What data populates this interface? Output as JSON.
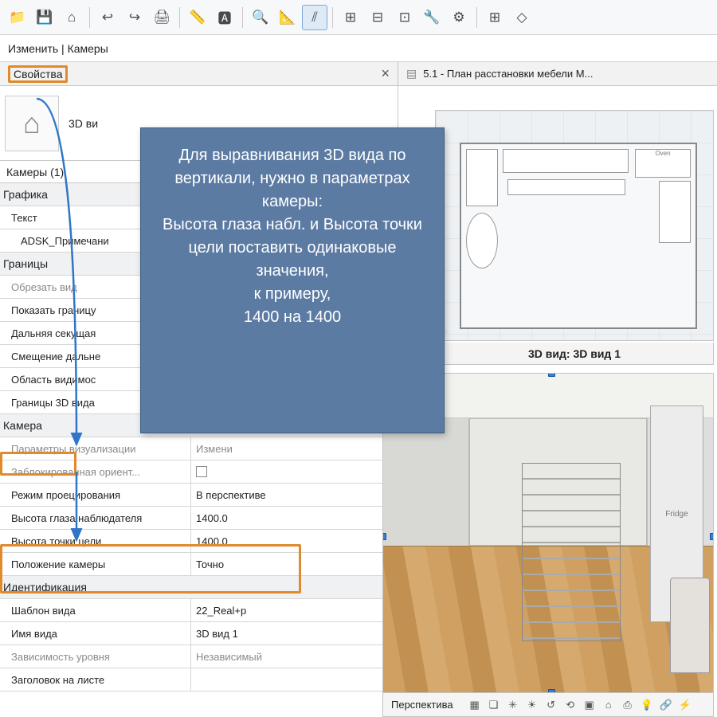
{
  "toolbar": {
    "icons": [
      "📁",
      "💾",
      "⌂",
      "↩",
      "↪",
      "🖨",
      "📏",
      "🅰",
      "🔍",
      "📐",
      "⫽",
      "⊞",
      "⊟",
      "⊡",
      "🔧",
      "⚙",
      "⊞",
      "◇"
    ]
  },
  "ribbon": {
    "tab_label": "Изменить | Камеры"
  },
  "properties_panel": {
    "title": "Свойства",
    "close": "×",
    "type": {
      "name": "3D ви",
      "thumb_glyph": "⌂"
    },
    "cameras_header": "Камеры (1)",
    "groups": [
      {
        "header": "Графика",
        "rows": [
          {
            "name": "Текст",
            "value": ""
          },
          {
            "name": "ADSK_Примечани",
            "value": "",
            "indent": true
          }
        ]
      },
      {
        "header": "Границы",
        "rows": [
          {
            "name": "Обрезать вид",
            "value": "",
            "greyname": true
          },
          {
            "name": "Показать границу",
            "value": ""
          },
          {
            "name": "Дальняя секущая",
            "value": ""
          },
          {
            "name": "Смещение дальне",
            "value": ""
          },
          {
            "name": "Область видимос",
            "value": ""
          },
          {
            "name": "Границы 3D вида",
            "value": ""
          }
        ]
      },
      {
        "header": "Камера",
        "rows": [
          {
            "name": "Параметры визуализации",
            "value": "Измени",
            "greyname": true,
            "greyval": true
          },
          {
            "name": "Заблокированная ориент...",
            "value": "",
            "greyname": true,
            "checkbox": true
          },
          {
            "name": "Режим проецирования",
            "value": "В перспективе"
          },
          {
            "name": "Высота глаза наблюдателя",
            "value": "1400.0"
          },
          {
            "name": "Высота точки цели",
            "value": "1400.0"
          },
          {
            "name": "Положение камеры",
            "value": "Точно"
          }
        ]
      },
      {
        "header": "Идентификация",
        "rows": [
          {
            "name": "Шаблон вида",
            "value": "22_Real+р"
          },
          {
            "name": "Имя вида",
            "value": "3D вид 1"
          },
          {
            "name": "Зависимость уровня",
            "value": "Независимый",
            "greyname": true,
            "greyval": true
          },
          {
            "name": "Заголовок на листе",
            "value": ""
          }
        ]
      }
    ]
  },
  "right_view": {
    "tab_title": "5.1 - План расстановки мебели М...",
    "plan_applabels": {
      "oven": "Oven"
    },
    "view_title": "3D вид: 3D вид 1",
    "fridge_label": "Fridge",
    "status_label": "Перспектива",
    "status_icons": [
      "▦",
      "❏",
      "✳",
      "☀",
      "↺",
      "⟲",
      "▣",
      "⌂",
      "⎙",
      "💡",
      "🔗",
      "⚡"
    ]
  },
  "callout": {
    "text": "Для выравнивания 3D вида по вертикали, нужно в параметрах камеры:\nВысота глаза набл. и Высота точки цели поставить одинаковые значения,\nк примеру,\n1400 на 1400"
  }
}
